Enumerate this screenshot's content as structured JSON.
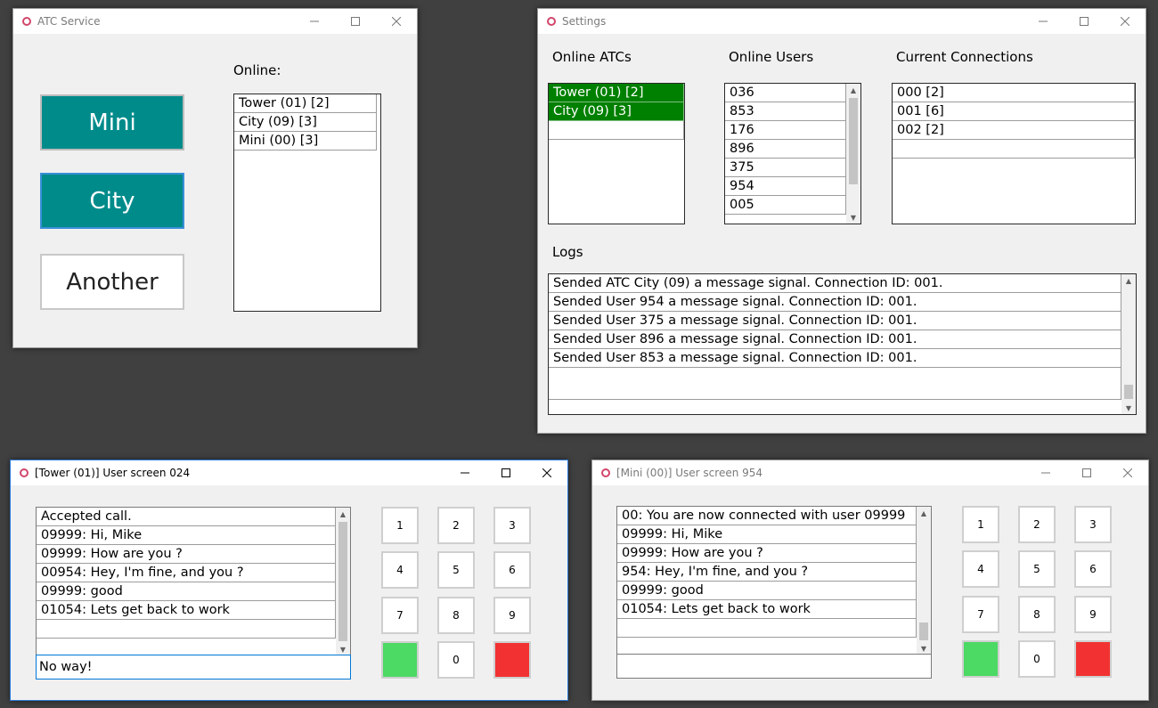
{
  "atc_window": {
    "title": "ATC Service",
    "buttons": [
      "Mini",
      "City",
      "Another"
    ],
    "online_label": "Online:",
    "online_items": [
      "Tower (01) [2]",
      "City (09) [3]",
      "Mini (00) [3]"
    ]
  },
  "settings_window": {
    "title": "Settings",
    "online_atcs_label": "Online ATCs",
    "online_atcs": [
      "Tower (01) [2]",
      "City (09) [3]"
    ],
    "online_users_label": "Online Users",
    "online_users": [
      "036",
      "853",
      "176",
      "896",
      "375",
      "954",
      "005"
    ],
    "connections_label": "Current Connections",
    "connections": [
      "000 [2]",
      "001 [6]",
      "002 [2]"
    ],
    "logs_label": "Logs",
    "logs": [
      "Sended ATC City (09) a message signal. Connection ID: 001.",
      "Sended User 954 a message signal. Connection ID: 001.",
      "Sended User 375 a message signal. Connection ID: 001.",
      "Sended User 896 a message signal. Connection ID: 001.",
      "Sended User 853 a message signal. Connection ID: 001."
    ]
  },
  "tower_window": {
    "title": "[Tower (01)] User screen 024",
    "messages": [
      "Accepted call.",
      "09999: Hi, Mike",
      "09999: How are you ?",
      "00954: Hey, I'm fine, and you ?",
      "09999: good",
      "01054: Lets get back to work"
    ],
    "input_value": "No way!",
    "keys": [
      "1",
      "2",
      "3",
      "4",
      "5",
      "6",
      "7",
      "8",
      "9",
      "0"
    ]
  },
  "mini_window": {
    "title": "[Mini (00)] User screen 954",
    "messages": [
      "00: You are now connected with user 09999",
      "09999: Hi, Mike",
      "09999: How are you ?",
      "954: Hey, I'm fine, and you ?",
      "09999: good",
      "01054: Lets get back to work"
    ],
    "input_value": "",
    "keys": [
      "1",
      "2",
      "3",
      "4",
      "5",
      "6",
      "7",
      "8",
      "9",
      "0"
    ]
  },
  "colors": {
    "desktop": "#404040",
    "teal_button": "#008b8b",
    "selected_row": "#008000",
    "accept_key": "#4cd964",
    "reject_key": "#f23232",
    "app_icon": "#d2466a"
  },
  "icons": {
    "app": "circle-ring-icon",
    "minimize": "minimize-icon",
    "maximize": "maximize-icon",
    "close": "close-icon"
  }
}
